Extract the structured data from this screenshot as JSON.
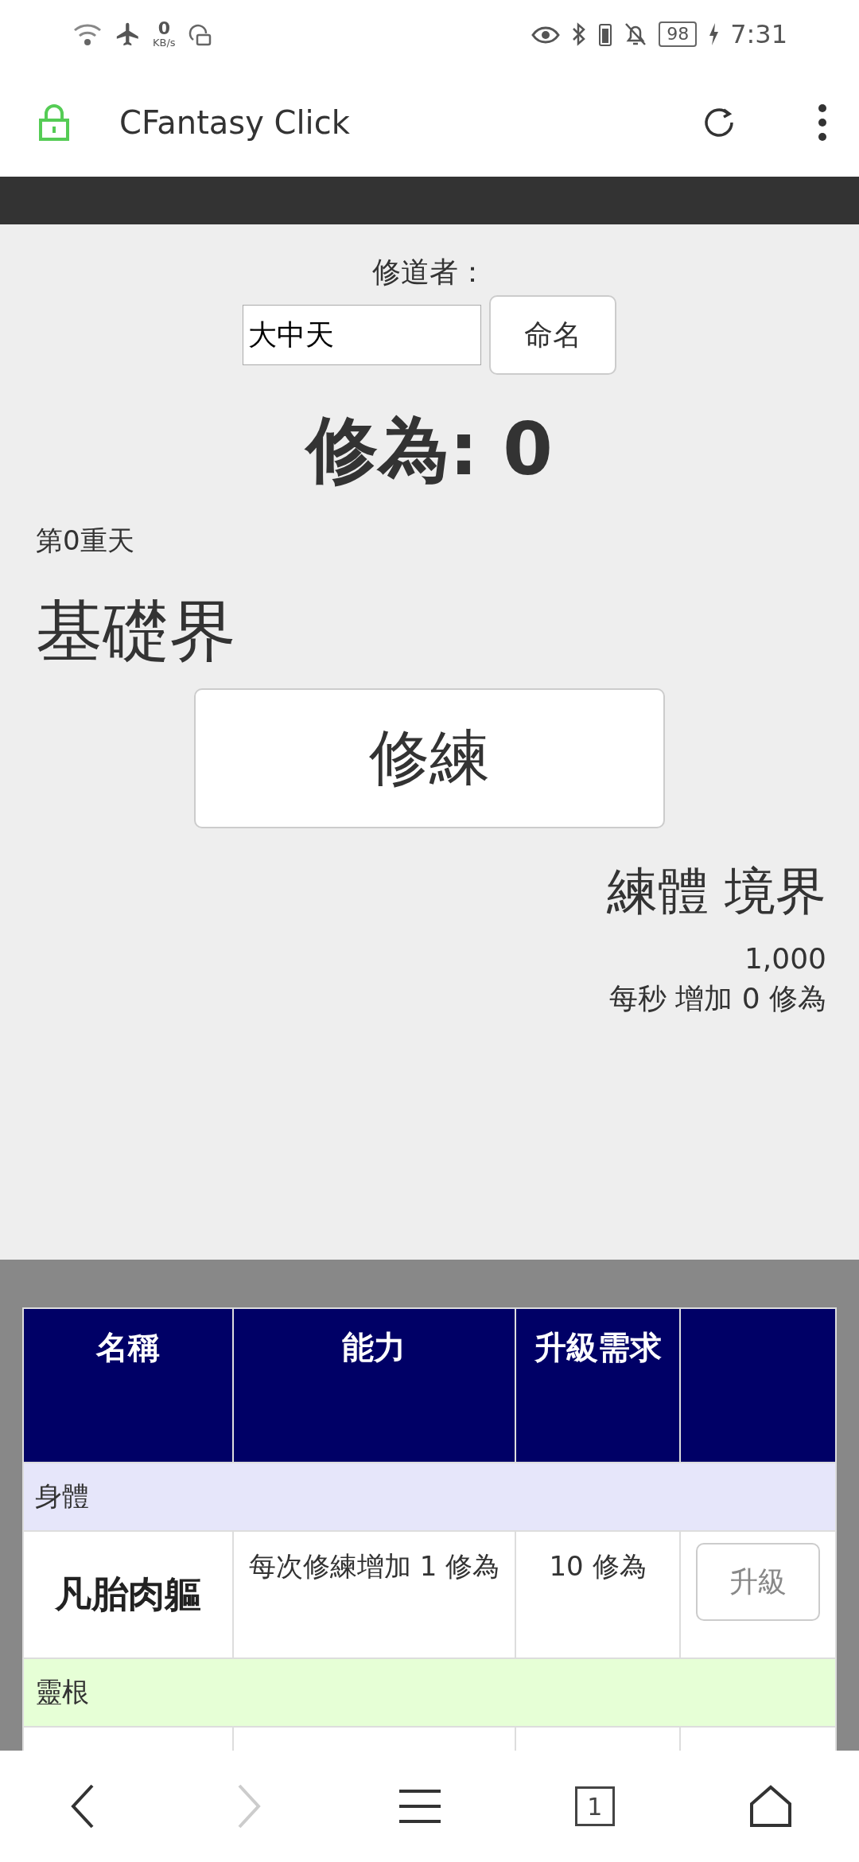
{
  "status_bar": {
    "net_speed": "0",
    "net_unit": "KB/s",
    "battery": "98",
    "time": "7:31"
  },
  "browser": {
    "title": "CFantasy Click"
  },
  "cultivator": {
    "label": "修道者：",
    "name_value": "大中天",
    "name_button": "命名"
  },
  "cultivation": {
    "points": "修為: 0",
    "layer": "第0重天",
    "realm": "基礎界",
    "train_button": "修練",
    "body_realm": "練體 境界",
    "amount": "1,000",
    "rate": "每秒 增加 0 修為"
  },
  "table": {
    "columns": [
      "名稱",
      "能力",
      "升級需求"
    ],
    "rows": [
      {
        "kind": "group",
        "label": "身體",
        "color": "#e6e6fa"
      },
      {
        "kind": "item",
        "name": "凡胎肉軀",
        "ability": "每次修練增加 1 修為",
        "cost": "10 修為",
        "button": "升級",
        "disabled": true
      },
      {
        "kind": "group",
        "label": "靈根",
        "color": "#e6ffd6"
      },
      {
        "kind": "clipped"
      }
    ]
  },
  "nav": {
    "tab_count": "1"
  }
}
